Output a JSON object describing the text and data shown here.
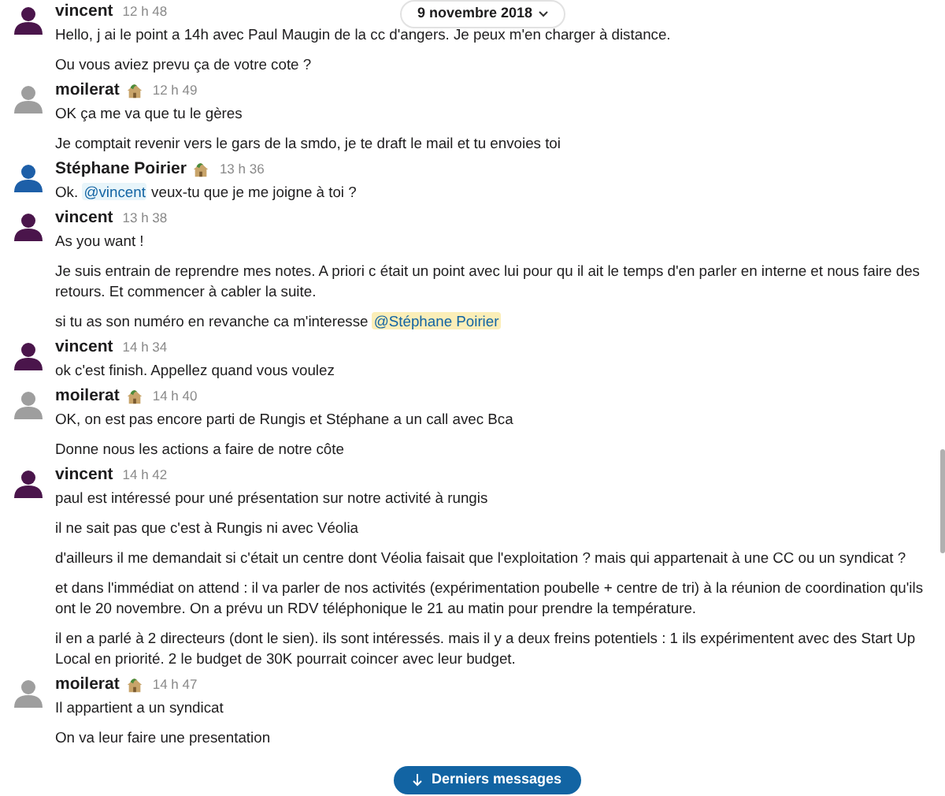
{
  "date_divider": {
    "label": "9 novembre 2018"
  },
  "groups": [
    {
      "author": "vincent",
      "color": "#4a154b",
      "status_emoji": false,
      "time": "12 h 48",
      "messages": [
        [
          {
            "kind": "text",
            "text": "Hello, j ai le point a 14h avec Paul Maugin de la cc d'angers. Je peux m'en charger à distance."
          }
        ],
        [
          {
            "kind": "text",
            "text": "Ou vous aviez prevu ça de votre cote ?"
          }
        ]
      ]
    },
    {
      "author": "moilerat",
      "color": "#9e9e9e",
      "status_emoji": true,
      "time": "12 h 49",
      "messages": [
        [
          {
            "kind": "text",
            "text": "OK ça me va que tu le gères"
          }
        ],
        [
          {
            "kind": "text",
            "text": "Je comptait revenir vers le gars de la smdo, je te draft le mail et tu envoies toi"
          }
        ]
      ]
    },
    {
      "author": "Stéphane Poirier",
      "color": "#1d5fa8",
      "status_emoji": true,
      "time": "13 h 36",
      "messages": [
        [
          {
            "kind": "text",
            "text": "Ok. "
          },
          {
            "kind": "mention",
            "text": "@vincent",
            "highlighted": false
          },
          {
            "kind": "text",
            "text": " veux-tu que je me joigne à toi ?"
          }
        ]
      ]
    },
    {
      "author": "vincent",
      "color": "#4a154b",
      "status_emoji": false,
      "time": "13 h 38",
      "messages": [
        [
          {
            "kind": "text",
            "text": "As you want !"
          }
        ],
        [
          {
            "kind": "text",
            "text": "Je suis entrain de reprendre mes notes. A priori c était un point avec lui pour qu il ait le temps d'en parler en interne et nous faire des retours. Et commencer à cabler la suite."
          }
        ],
        [
          {
            "kind": "text",
            "text": "si tu as son numéro en revanche ca m'interesse "
          },
          {
            "kind": "mention",
            "text": "@Stéphane Poirier",
            "highlighted": true
          }
        ]
      ]
    },
    {
      "author": "vincent",
      "color": "#4a154b",
      "status_emoji": false,
      "time": "14 h 34",
      "messages": [
        [
          {
            "kind": "text",
            "text": "ok c'est finish. Appellez quand vous voulez"
          }
        ]
      ]
    },
    {
      "author": "moilerat",
      "color": "#9e9e9e",
      "status_emoji": true,
      "time": "14 h 40",
      "messages": [
        [
          {
            "kind": "text",
            "text": "OK, on est pas encore parti de Rungis et Stéphane a un call avec Bca"
          }
        ],
        [
          {
            "kind": "text",
            "text": "Donne nous les actions a faire de notre côte"
          }
        ]
      ]
    },
    {
      "author": "vincent",
      "color": "#4a154b",
      "status_emoji": false,
      "time": "14 h 42",
      "messages": [
        [
          {
            "kind": "text",
            "text": "paul est intéressé pour uné présentation sur notre activité à rungis"
          }
        ],
        [
          {
            "kind": "text",
            "text": "il ne sait pas que c'est à Rungis ni avec Véolia"
          }
        ],
        [
          {
            "kind": "text",
            "text": "d'ailleurs il me demandait si c'était un centre dont Véolia faisait que l'exploitation ? mais qui appartenait à une CC ou un syndicat ?"
          }
        ],
        [
          {
            "kind": "text",
            "text": "et dans l'immédiat on attend : il va parler de nos activités (expérimentation poubelle + centre de tri) à la réunion de coordination qu'ils ont le 20 novembre. On a prévu un RDV téléphonique le 21 au matin pour prendre la température."
          }
        ],
        [
          {
            "kind": "text",
            "text": "il en a parlé à 2 directeurs (dont le sien). ils sont intéressés. mais il y a deux freins potentiels : 1 ils expérimentent avec des Start Up Local en priorité. 2 le budget de 30K pourrait coincer avec leur budget."
          }
        ]
      ]
    },
    {
      "author": "moilerat",
      "color": "#9e9e9e",
      "status_emoji": true,
      "time": "14 h 47",
      "messages": [
        [
          {
            "kind": "text",
            "text": "Il appartient a un syndicat"
          }
        ],
        [
          {
            "kind": "text",
            "text": "On va leur faire une presentation"
          }
        ]
      ]
    }
  ],
  "jump_button": {
    "label": "Derniers messages"
  }
}
